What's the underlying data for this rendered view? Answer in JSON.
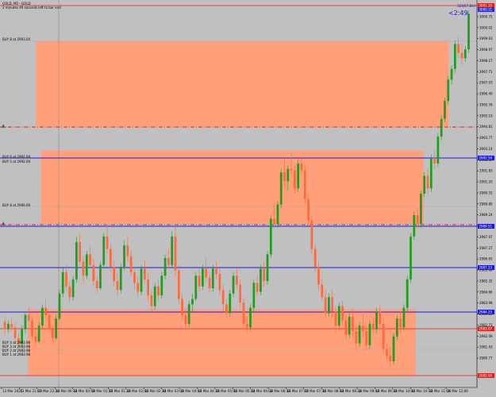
{
  "header": {
    "symbol_line": "GOLD, M5 - GOLD",
    "info_line": "2 minutes 49 seconds left to bar end"
  },
  "timer": "<2:49",
  "spread_label": "32467.Bid",
  "order_labels": [
    "BUY 8 at 2993.04",
    "BUY 6 at 2992.69",
    "BUY 5 at 2992.69",
    "BUY 8 at 2990.69"
  ],
  "order_cluster_labels": [
    "BUY 4 at 2983.98",
    "BUY 3 at 2983.98",
    "BUY 2 at 2983.98",
    "BUY 1 at 2983.98"
  ],
  "price_axis": {
    "labels": [
      "3000.75",
      "3000.02",
      "2999.63",
      "2998.97",
      "2998.27",
      "2997.71",
      "2997.03",
      "2996.40",
      "2995.76",
      "2995.10",
      "2994.81",
      "2993.77",
      "2993.14",
      "2992.49",
      "2991.83",
      "2991.20",
      "2990.55",
      "2989.89",
      "2989.24",
      "2988.64",
      "2987.97",
      "2987.27",
      "2986.65",
      "2985.98",
      "2985.32",
      "2984.66",
      "2983.98",
      "2983.39",
      "2982.73",
      "2982.09",
      "2981.43",
      "2980.77"
    ]
  },
  "price_tags": [
    "3001.35",
    "3000.11",
    "2992.59",
    "2989.51",
    "2987.23",
    "2984.25",
    "2983.07",
    "2982.00"
  ],
  "time_axis": {
    "labels": [
      "13 Mar 2025",
      "13 Mar 21:00",
      "13 Mar 22:20",
      "14 Mar 00:30",
      "14 Mar 00:50",
      "14 Mar 01:10",
      "14 Mar 01:30",
      "14 Mar 02:00",
      "14 Mar 02:30",
      "14 Mar 03:00",
      "14 Mar 04:00",
      "14 Mar 04:30",
      "14 Mar 05:00",
      "14 Mar 05:30",
      "14 Mar 06:00",
      "14 Mar 06:30",
      "14 Mar 07:00",
      "14 Mar 07:30",
      "14 Mar 08:00",
      "14 Mar 08:30",
      "14 Mar 09:00",
      "14 Mar 09:30",
      "14 Mar 10:00",
      "14 Mar 10:30",
      "14 Mar 11:00",
      "14 Mar 12:00"
    ]
  },
  "colors": {
    "background": "#c0c0c0",
    "zone_fill": "#ffa07a",
    "candle_up": "#1f9e1f",
    "candle_down": "#ff6a3d",
    "line_blue": "#1a1adc",
    "line_red": "#e02020",
    "grid_gray": "#9a9a9a"
  },
  "chart_data": {
    "type": "candlestick",
    "symbol": "GOLD",
    "timeframe": "M5",
    "y_range": [
      2980.4,
      3001.6
    ],
    "bar_count": 140,
    "ohlc": [
      [
        2983.8,
        2984.1,
        2983.1,
        2983.4
      ],
      [
        2983.4,
        2983.9,
        2983.2,
        2983.7
      ],
      [
        2983.7,
        2984.0,
        2983.3,
        2983.5
      ],
      [
        2983.5,
        2983.8,
        2982.6,
        2982.9
      ],
      [
        2982.9,
        2983.2,
        2982.4,
        2982.6
      ],
      [
        2982.6,
        2983.6,
        2982.5,
        2983.4
      ],
      [
        2983.4,
        2984.4,
        2983.2,
        2984.2
      ],
      [
        2984.2,
        2984.6,
        2983.8,
        2983.9
      ],
      [
        2983.9,
        2984.1,
        2982.8,
        2983.0
      ],
      [
        2983.0,
        2983.4,
        2982.4,
        2982.7
      ],
      [
        2982.7,
        2983.8,
        2982.6,
        2983.6
      ],
      [
        2983.6,
        2984.8,
        2983.4,
        2984.6
      ],
      [
        2984.6,
        2985.1,
        2984.0,
        2984.2
      ],
      [
        2984.2,
        2984.4,
        2983.2,
        2983.4
      ],
      [
        2983.4,
        2983.6,
        2982.7,
        2982.9
      ],
      [
        2982.9,
        2984.2,
        2982.8,
        2984.0
      ],
      [
        2984.0,
        2985.6,
        2983.9,
        2985.4
      ],
      [
        2985.4,
        2986.9,
        2985.2,
        2986.6
      ],
      [
        2986.6,
        2987.0,
        2985.6,
        2985.8
      ],
      [
        2985.8,
        2986.1,
        2984.9,
        2985.2
      ],
      [
        2985.2,
        2986.4,
        2985.0,
        2986.2
      ],
      [
        2986.2,
        2988.6,
        2986.0,
        2988.3
      ],
      [
        2988.3,
        2988.8,
        2987.0,
        2987.2
      ],
      [
        2987.2,
        2987.5,
        2986.0,
        2986.4
      ],
      [
        2986.4,
        2987.8,
        2986.2,
        2987.6
      ],
      [
        2987.6,
        2988.1,
        2986.8,
        2987.0
      ],
      [
        2987.0,
        2987.4,
        2985.8,
        2986.1
      ],
      [
        2986.1,
        2986.4,
        2985.4,
        2985.7
      ],
      [
        2985.7,
        2987.2,
        2985.6,
        2987.0
      ],
      [
        2987.0,
        2988.8,
        2986.8,
        2988.6
      ],
      [
        2988.6,
        2989.3,
        2987.6,
        2987.9
      ],
      [
        2987.9,
        2988.2,
        2986.6,
        2986.9
      ],
      [
        2986.9,
        2987.3,
        2985.8,
        2986.1
      ],
      [
        2986.1,
        2986.5,
        2985.3,
        2985.6
      ],
      [
        2985.6,
        2987.1,
        2985.4,
        2986.9
      ],
      [
        2986.9,
        2988.4,
        2986.7,
        2988.1
      ],
      [
        2988.1,
        2988.6,
        2987.2,
        2987.5
      ],
      [
        2987.5,
        2987.8,
        2986.3,
        2986.6
      ],
      [
        2986.6,
        2986.9,
        2985.6,
        2986.0
      ],
      [
        2986.0,
        2986.3,
        2985.2,
        2985.5
      ],
      [
        2985.5,
        2987.0,
        2985.3,
        2986.8
      ],
      [
        2986.8,
        2987.3,
        2986.0,
        2986.2
      ],
      [
        2986.2,
        2986.6,
        2985.0,
        2985.3
      ],
      [
        2985.3,
        2985.6,
        2984.4,
        2984.7
      ],
      [
        2984.7,
        2986.0,
        2984.5,
        2985.8
      ],
      [
        2985.8,
        2986.2,
        2985.0,
        2985.3
      ],
      [
        2985.3,
        2986.6,
        2985.1,
        2986.4
      ],
      [
        2986.4,
        2987.6,
        2986.2,
        2987.4
      ],
      [
        2987.4,
        2987.9,
        2986.8,
        2987.0
      ],
      [
        2987.0,
        2988.9,
        2986.8,
        2988.6
      ],
      [
        2988.6,
        2989.1,
        2986.4,
        2986.7
      ],
      [
        2986.7,
        2987.0,
        2984.8,
        2985.1
      ],
      [
        2985.1,
        2985.4,
        2983.9,
        2984.2
      ],
      [
        2984.2,
        2984.6,
        2983.4,
        2983.7
      ],
      [
        2983.7,
        2985.0,
        2983.5,
        2984.8
      ],
      [
        2984.8,
        2985.4,
        2984.4,
        2985.1
      ],
      [
        2985.1,
        2986.6,
        2985.0,
        2986.4
      ],
      [
        2986.4,
        2986.8,
        2985.5,
        2985.8
      ],
      [
        2985.8,
        2987.0,
        2985.6,
        2986.8
      ],
      [
        2986.8,
        2987.4,
        2986.0,
        2986.3
      ],
      [
        2986.3,
        2986.6,
        2985.4,
        2985.7
      ],
      [
        2985.7,
        2987.0,
        2985.5,
        2986.8
      ],
      [
        2986.8,
        2987.2,
        2986.2,
        2986.5
      ],
      [
        2986.5,
        2986.8,
        2985.3,
        2985.6
      ],
      [
        2985.6,
        2985.9,
        2984.5,
        2984.8
      ],
      [
        2984.8,
        2985.1,
        2984.0,
        2984.3
      ],
      [
        2984.3,
        2985.6,
        2984.1,
        2985.4
      ],
      [
        2985.4,
        2986.6,
        2985.2,
        2986.4
      ],
      [
        2986.4,
        2986.8,
        2985.6,
        2985.9
      ],
      [
        2985.9,
        2986.2,
        2984.6,
        2984.9
      ],
      [
        2984.9,
        2985.2,
        2983.4,
        2983.7
      ],
      [
        2983.7,
        2984.1,
        2983.2,
        2983.5
      ],
      [
        2983.5,
        2984.8,
        2983.3,
        2984.6
      ],
      [
        2984.6,
        2986.2,
        2984.4,
        2986.0
      ],
      [
        2986.0,
        2986.4,
        2985.2,
        2985.5
      ],
      [
        2985.5,
        2987.0,
        2985.3,
        2986.8
      ],
      [
        2986.8,
        2987.2,
        2985.8,
        2986.1
      ],
      [
        2986.1,
        2987.8,
        2985.9,
        2987.6
      ],
      [
        2987.6,
        2989.8,
        2987.4,
        2989.6
      ],
      [
        2989.6,
        2990.4,
        2989.0,
        2989.3
      ],
      [
        2989.3,
        2990.6,
        2989.1,
        2990.4
      ],
      [
        2990.4,
        2992.4,
        2990.2,
        2992.2
      ],
      [
        2992.2,
        2993.0,
        2991.4,
        2991.7
      ],
      [
        2991.7,
        2992.6,
        2991.2,
        2992.4
      ],
      [
        2992.4,
        2993.3,
        2992.0,
        2992.3
      ],
      [
        2992.3,
        2992.6,
        2991.0,
        2991.3
      ],
      [
        2991.3,
        2992.9,
        2991.1,
        2992.7
      ],
      [
        2992.7,
        2993.1,
        2992.0,
        2992.3
      ],
      [
        2992.3,
        2992.6,
        2990.4,
        2990.7
      ],
      [
        2990.7,
        2991.0,
        2989.2,
        2989.5
      ],
      [
        2989.5,
        2989.8,
        2987.6,
        2987.9
      ],
      [
        2987.9,
        2988.2,
        2986.6,
        2986.9
      ],
      [
        2986.9,
        2987.2,
        2985.6,
        2985.9
      ],
      [
        2985.9,
        2986.2,
        2985.0,
        2985.2
      ],
      [
        2985.2,
        2985.6,
        2984.0,
        2984.3
      ],
      [
        2984.3,
        2985.4,
        2984.1,
        2985.2
      ],
      [
        2985.2,
        2985.6,
        2984.0,
        2984.4
      ],
      [
        2984.4,
        2984.7,
        2983.2,
        2983.6
      ],
      [
        2983.6,
        2984.9,
        2983.4,
        2984.7
      ],
      [
        2984.7,
        2985.0,
        2983.6,
        2983.9
      ],
      [
        2983.9,
        2984.2,
        2982.8,
        2983.1
      ],
      [
        2983.1,
        2984.3,
        2982.9,
        2984.1
      ],
      [
        2984.1,
        2984.5,
        2983.0,
        2983.3
      ],
      [
        2983.3,
        2983.6,
        2982.3,
        2982.6
      ],
      [
        2982.6,
        2983.8,
        2982.4,
        2983.6
      ],
      [
        2983.6,
        2984.4,
        2983.0,
        2983.3
      ],
      [
        2983.3,
        2983.6,
        2982.2,
        2982.5
      ],
      [
        2982.5,
        2983.9,
        2982.3,
        2983.7
      ],
      [
        2983.7,
        2984.1,
        2983.1,
        2983.4
      ],
      [
        2983.4,
        2984.6,
        2983.2,
        2984.4
      ],
      [
        2984.4,
        2984.8,
        2983.4,
        2983.7
      ],
      [
        2983.7,
        2984.0,
        2982.0,
        2982.3
      ],
      [
        2982.3,
        2982.6,
        2981.6,
        2981.9
      ],
      [
        2981.9,
        2982.4,
        2981.3,
        2981.6
      ],
      [
        2981.6,
        2983.2,
        2981.4,
        2983.0
      ],
      [
        2983.0,
        2984.2,
        2982.8,
        2984.0
      ],
      [
        2984.0,
        2984.4,
        2983.2,
        2983.5
      ],
      [
        2983.5,
        2984.8,
        2983.3,
        2984.6
      ],
      [
        2984.6,
        2986.4,
        2984.4,
        2986.2
      ],
      [
        2986.2,
        2988.8,
        2986.0,
        2988.6
      ],
      [
        2988.6,
        2990.0,
        2988.4,
        2989.8
      ],
      [
        2989.8,
        2990.2,
        2989.0,
        2989.3
      ],
      [
        2989.3,
        2991.2,
        2989.1,
        2991.0
      ],
      [
        2991.0,
        2992.2,
        2990.8,
        2992.0
      ],
      [
        2992.0,
        2992.4,
        2991.0,
        2991.3
      ],
      [
        2991.3,
        2993.2,
        2991.1,
        2993.0
      ],
      [
        2993.0,
        2993.5,
        2992.4,
        2992.7
      ],
      [
        2992.7,
        2994.4,
        2992.5,
        2994.2
      ],
      [
        2994.2,
        2995.4,
        2994.0,
        2995.2
      ],
      [
        2995.2,
        2996.4,
        2995.0,
        2996.2
      ],
      [
        2996.2,
        2997.6,
        2996.0,
        2997.4
      ],
      [
        2997.4,
        2998.2,
        2997.1,
        2998.0
      ],
      [
        2998.0,
        2999.6,
        2997.8,
        2999.4
      ],
      [
        2999.4,
        2999.8,
        2998.6,
        2998.9
      ],
      [
        2998.9,
        2999.4,
        2998.2,
        2998.6
      ],
      [
        2998.6,
        2999.3,
        2998.4,
        2999.1
      ],
      [
        2999.1,
        3001.3,
        2998.9,
        3001.1
      ]
    ]
  }
}
